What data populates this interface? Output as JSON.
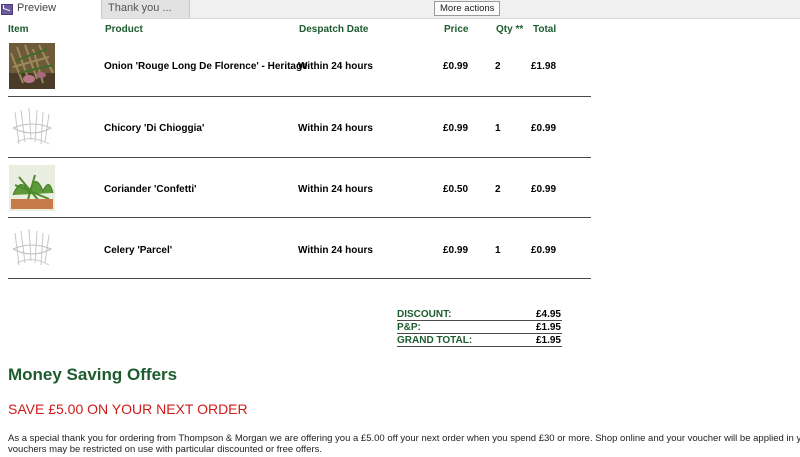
{
  "tabs": [
    {
      "label": "Preview"
    },
    {
      "label": "Thank you ..."
    }
  ],
  "toolbar": {
    "more_actions_label": "More actions"
  },
  "table": {
    "headers": {
      "item": "Item",
      "product": "Product",
      "despatch": "Despatch Date",
      "price": "Price",
      "qty": "Qty **",
      "total": "Total"
    },
    "rows": [
      {
        "product": "Onion 'Rouge Long De Florence' - Heritage",
        "despatch": "Within 24 hours",
        "price": "£0.99",
        "qty": "2",
        "total": "£1.98",
        "image": "onion-photo"
      },
      {
        "product": "Chicory 'Di Chioggia'",
        "despatch": "Within 24 hours",
        "price": "£0.99",
        "qty": "1",
        "total": "£0.99",
        "image": "placeholder-sketch"
      },
      {
        "product": "Coriander 'Confetti'",
        "despatch": "Within 24 hours",
        "price": "£0.50",
        "qty": "2",
        "total": "£0.99",
        "image": "coriander-photo"
      },
      {
        "product": "Celery 'Parcel'",
        "despatch": "Within 24 hours",
        "price": "£0.99",
        "qty": "1",
        "total": "£0.99",
        "image": "placeholder-sketch"
      }
    ]
  },
  "totals": {
    "discount_label": "DISCOUNT:",
    "discount_value": "£4.95",
    "pp_label": "P&P:",
    "pp_value": "£1.95",
    "grand_label": "GRAND TOTAL:",
    "grand_value": "£1.95"
  },
  "offers": {
    "title": "Money Saving Offers",
    "save_title": "SAVE £5.00 ON YOUR NEXT ORDER",
    "para_line1": "As a special thank you for ordering from Thompson & Morgan we are offering you a £5.00 off your next order when you spend £30 or more. Shop online and your voucher will be applied in yo",
    "para_line2": "vouchers may be restricted on use with particular discounted or free offers."
  },
  "colors": {
    "heading_green": "#1d5c2e",
    "offer_red": "#d11a1a"
  }
}
